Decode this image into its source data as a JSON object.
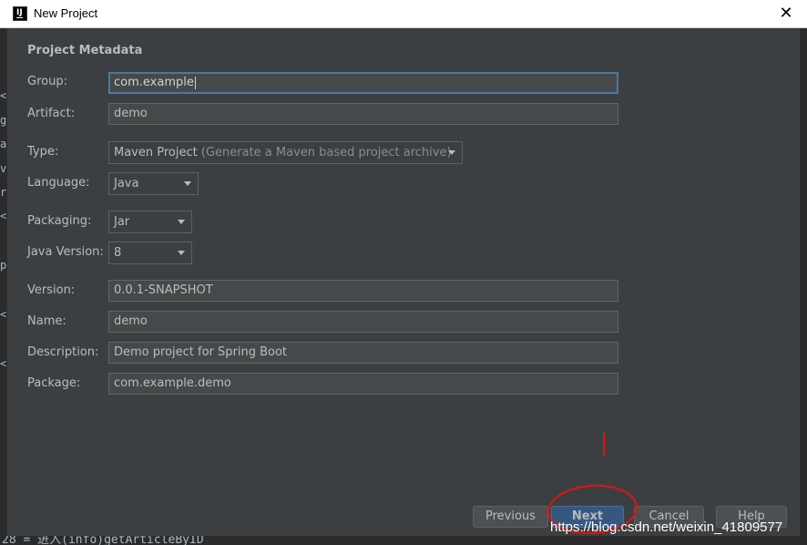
{
  "window": {
    "title": "New Project",
    "app_icon_letter": "IJ",
    "close_glyph": "✕"
  },
  "dialog": {
    "section_title": "Project Metadata",
    "fields": {
      "group": {
        "label": "Group:",
        "value": "com.example"
      },
      "artifact": {
        "label": "Artifact:",
        "value": "demo"
      },
      "type": {
        "label": "Type:",
        "value": "Maven Project",
        "hint": "(Generate a Maven based project archive)"
      },
      "language": {
        "label": "Language:",
        "value": "Java"
      },
      "packaging": {
        "label": "Packaging:",
        "value": "Jar"
      },
      "java_version": {
        "label": "Java Version:",
        "value": "8"
      },
      "version": {
        "label": "Version:",
        "value": "0.0.1-SNAPSHOT"
      },
      "name": {
        "label": "Name:",
        "value": "demo"
      },
      "description": {
        "label": "Description:",
        "value": "Demo project for Spring Boot"
      },
      "package": {
        "label": "Package:",
        "value": "com.example.demo"
      }
    },
    "buttons": {
      "previous": "Previous",
      "next": "Next",
      "cancel": "Cancel",
      "help": "Help"
    }
  },
  "background_editor": {
    "glyphs": [
      "<",
      "g",
      "a",
      "v",
      "r",
      "<",
      "p",
      "<",
      "<"
    ],
    "bottom_line": "28 = 进入(info)getArticleByID"
  },
  "watermark": "https://blog.csdn.net/weixin_41809577",
  "colors": {
    "dialog_bg": "#3c3f41",
    "focus_border": "#4a79a0",
    "default_button": "#365880",
    "annotation_red": "#e81010"
  }
}
